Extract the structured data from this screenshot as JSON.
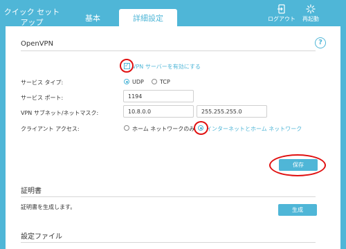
{
  "header": {
    "tabs": {
      "quick_line1": "クイック セット",
      "quick_line2": "アップ",
      "basic": "基本",
      "advanced": "詳細設定"
    },
    "logout": "ログアウト",
    "reboot": "再起動"
  },
  "openvpn": {
    "title": "OpenVPN",
    "enable_label": "VPN サーバーを有効にする",
    "enable_checked": true,
    "service_type_label": "サービス タイプ:",
    "service_types": [
      "UDP",
      "TCP"
    ],
    "service_type_selected": "UDP",
    "service_port_label": "サービス ポート:",
    "service_port": "1194",
    "subnet_label": "VPN サブネット/ネットマスク:",
    "subnet": "10.8.0.0",
    "netmask": "255.255.255.0",
    "client_access_label": "クライアント アクセス:",
    "client_access_options": [
      "ホーム ネットワークのみ",
      "インターネットとホーム ネットワーク"
    ],
    "client_access_selected": "インターネットとホーム ネットワーク",
    "save_button": "保存"
  },
  "certificate": {
    "title": "証明書",
    "description": "証明書を生成します。",
    "generate_button": "生成"
  },
  "config_file": {
    "title": "設定ファイル"
  },
  "colors": {
    "accent": "#4fb6d7",
    "annotation": "#e01010"
  },
  "icons": [
    "logout-icon",
    "reboot-icon",
    "help-icon"
  ]
}
